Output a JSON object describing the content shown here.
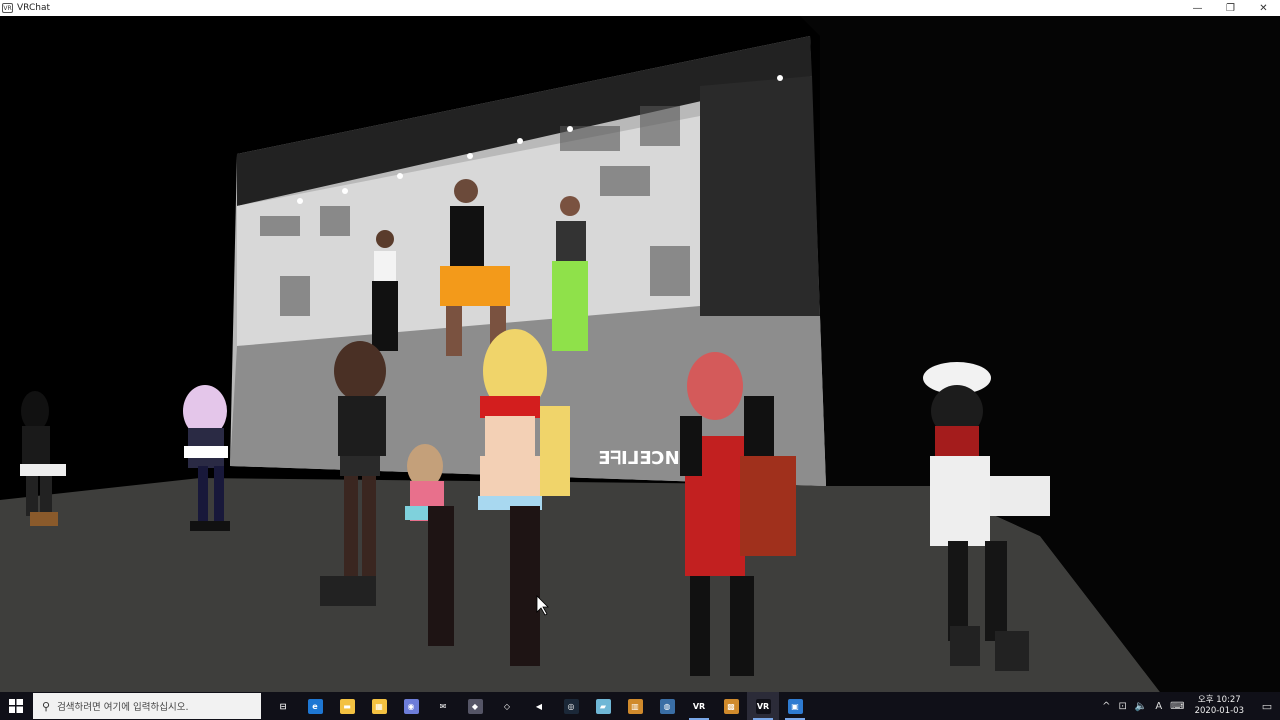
{
  "window": {
    "title": "VRChat",
    "app_icon_text": "VR",
    "minimize_glyph": "—",
    "restore_glyph": "❐",
    "close_glyph": "✕"
  },
  "scene": {
    "screen_text": "DANCELIFE"
  },
  "taskbar": {
    "start_icon": "windows-logo-icon",
    "search": {
      "icon": "search-icon",
      "placeholder": "검색하려면 여기에 입력하십시오."
    },
    "apps": [
      {
        "name": "task-view",
        "label": "⊟",
        "color": "#101018",
        "running": false
      },
      {
        "name": "edge",
        "label": "e",
        "color": "#1e77d3",
        "running": false
      },
      {
        "name": "file-explorer",
        "label": "▬",
        "color": "#f3c141",
        "running": false
      },
      {
        "name": "store",
        "label": "▦",
        "color": "#f3c141",
        "running": false
      },
      {
        "name": "discord",
        "label": "◉",
        "color": "#6d7dd9",
        "running": false
      },
      {
        "name": "mail",
        "label": "✉",
        "color": "#101018",
        "running": false
      },
      {
        "name": "app-7",
        "label": "◆",
        "color": "#556",
        "running": false
      },
      {
        "name": "unity",
        "label": "◇",
        "color": "#101018",
        "running": false
      },
      {
        "name": "visual-studio",
        "label": "◀",
        "color": "#101018",
        "running": false
      },
      {
        "name": "steam",
        "label": "◎",
        "color": "#1b2838",
        "running": false
      },
      {
        "name": "app-11",
        "label": "▰",
        "color": "#6fb7d6",
        "running": false
      },
      {
        "name": "app-12",
        "label": "▥",
        "color": "#d08a2c",
        "running": false
      },
      {
        "name": "app-13",
        "label": "◍",
        "color": "#3a6ea5",
        "running": false
      },
      {
        "name": "vr-1",
        "label": "VR",
        "color": "#101018",
        "running": true
      },
      {
        "name": "app-15",
        "label": "▩",
        "color": "#d08a2c",
        "running": false
      },
      {
        "name": "vr-2",
        "label": "VR",
        "color": "#101018",
        "running": true,
        "active": true
      },
      {
        "name": "app-17",
        "label": "▣",
        "color": "#2e7bd1",
        "running": true
      }
    ],
    "tray": {
      "chevron": "^",
      "network": "⊡",
      "volume": "🔈",
      "ime": "A",
      "ime2": "⌨"
    },
    "clock": {
      "time": "오후 10:27",
      "date": "2020-01-03"
    },
    "notification_icon": "▭"
  }
}
